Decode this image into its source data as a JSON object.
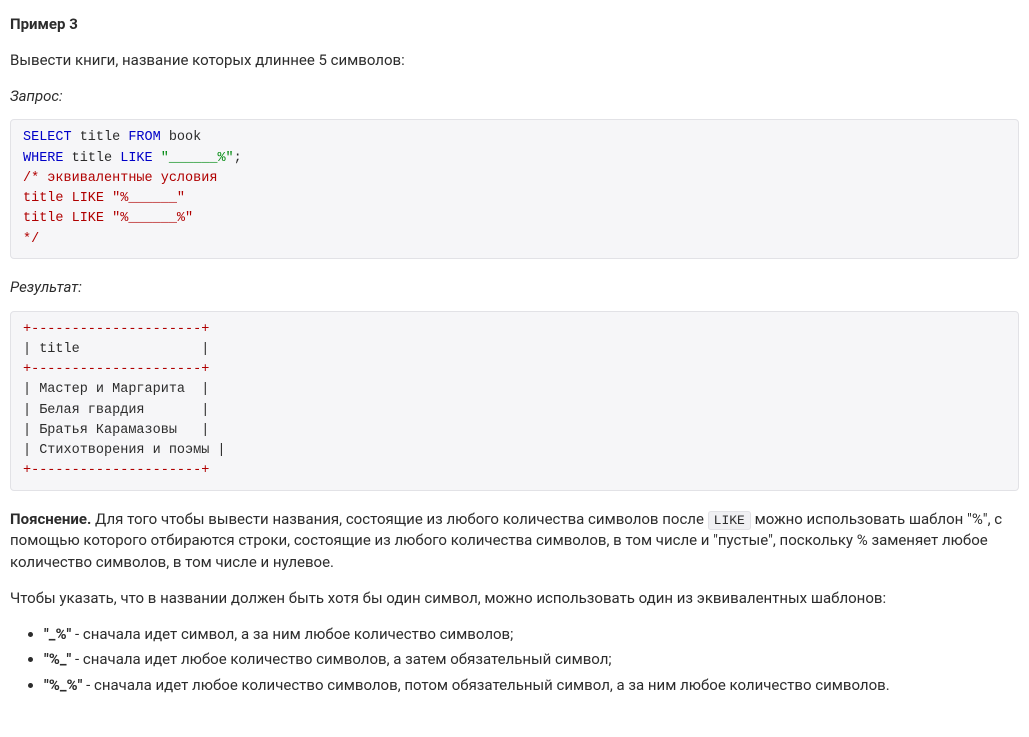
{
  "heading": "Пример 3",
  "task": "Вывести книги, название которых длиннее 5 символов:",
  "label_query": "Запрос:",
  "label_result": "Результат:",
  "sql": {
    "kw1": "SELECT",
    "col": " title ",
    "kw2": "FROM",
    "tbl": " book",
    "kw3": "WHERE",
    "col2": " title ",
    "kw4": "LIKE",
    "sp": " ",
    "str": "\"______%\"",
    "semi": ";",
    "c1": "/* эквивалентные условия",
    "c2": "title LIKE \"%______\"",
    "c3": "title LIKE \"%______%\"",
    "c4": "*/"
  },
  "result": {
    "border": "+---------------------+",
    "head": "| title               |",
    "rows": [
      "| Мастер и Маргарита  |",
      "| Белая гвардия       |",
      "| Братья Карамазовы   |",
      "| Стихотворения и поэмы |"
    ]
  },
  "explanation": {
    "label": "Пояснение.",
    "sp": "  ",
    "part1": "Для того чтобы вывести названия, состоящие из любого количества символов после ",
    "code": "LIKE",
    "part2": " можно использовать шаблон \"%\", с помощью которого отбираются строки, состоящие из любого количества символов, в том числе и \"пустые\", поскольку % заменяет любое количество символов, в том числе и нулевое."
  },
  "para2": "Чтобы указать, что в названии должен быть хотя бы один символ, можно использовать один из эквивалентных шаблонов:",
  "bullets": [
    {
      "pat": "\"_%\"",
      "text": " - сначала идет символ, а за ним любое количество символов;"
    },
    {
      "pat": "\"%_\"",
      "text": " - сначала идет любое количество символов, а затем обязательный символ;"
    },
    {
      "pat": "\"%_%\"",
      "text": " - сначала идет любое количество символов, потом обязательный символ, а за ним любое количество символов."
    }
  ]
}
